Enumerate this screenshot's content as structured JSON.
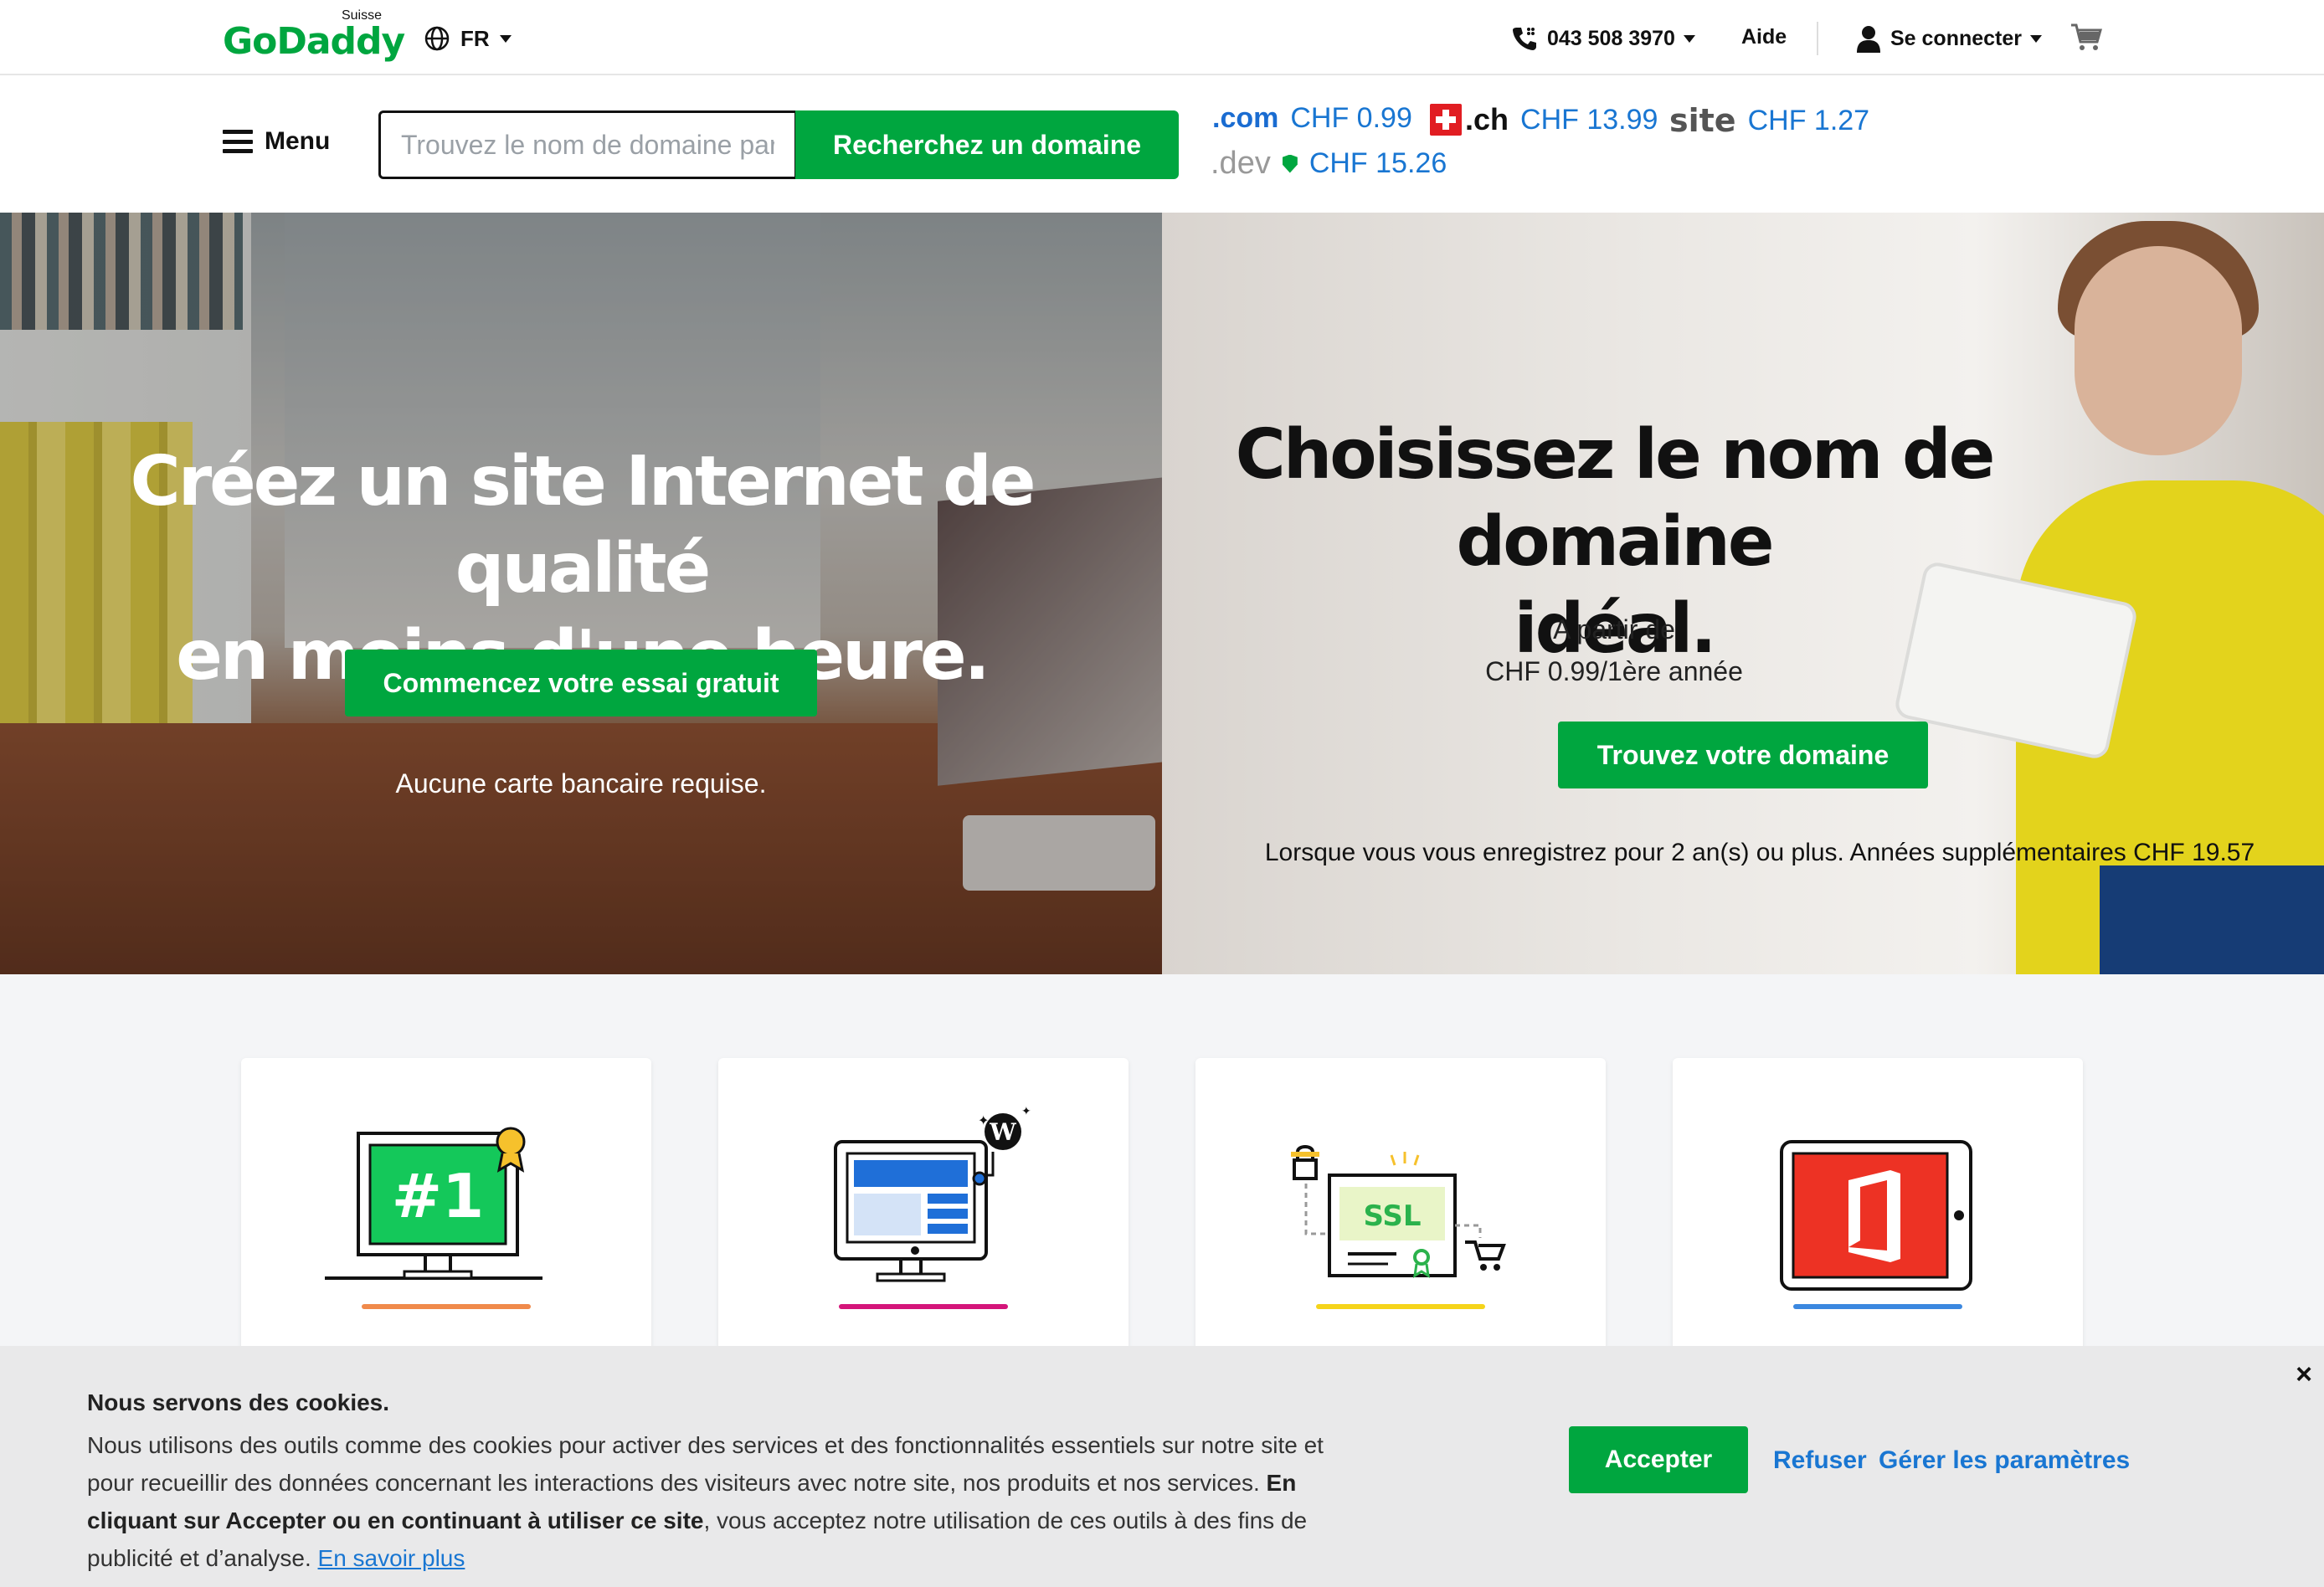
{
  "topbar": {
    "logo_text": "GoDaddy",
    "logo_region": "Suisse",
    "language": "FR",
    "phone": "043 508 3970",
    "help": "Aide",
    "login": "Se connecter"
  },
  "search": {
    "menu_label": "Menu",
    "placeholder": "Trouvez le nom de domaine parfait",
    "button": "Recherchez un domaine",
    "tlds": [
      {
        "ext": ".com",
        "price": "CHF 0.99"
      },
      {
        "ext": ".ch",
        "price": "CHF 13.99"
      },
      {
        "ext": "site",
        "price": "CHF 1.27"
      },
      {
        "ext": ".dev",
        "price": "CHF 15.26"
      }
    ]
  },
  "hero_left": {
    "headline_line1": "Créez un site Internet de qualité",
    "headline_line2": "en moins d'une heure.",
    "cta": "Commencez votre essai gratuit",
    "note": "Aucune carte bancaire requise."
  },
  "hero_right": {
    "headline_line1": "Choisissez le nom de domaine",
    "headline_line2": "idéal.",
    "sub1": "A partir de",
    "sub2": "CHF 0.99/1ère année",
    "cta": "Trouvez votre domaine",
    "disclaimer": "Lorsque vous vous enregistrez pour 2 an(s) ou plus. Années supplémentaires CHF 19.57"
  },
  "products": {
    "cards": [
      {
        "icon": "ranking-number-one-icon",
        "accent": "#f08a4b"
      },
      {
        "icon": "website-builder-wordpress-icon",
        "accent": "#d4157a"
      },
      {
        "icon": "ssl-certificate-icon",
        "accent": "#f5d41a"
      },
      {
        "icon": "office-365-icon",
        "accent": "#3b88e0"
      }
    ],
    "ssl_label": "SSL"
  },
  "cookie": {
    "title": "Nous servons des cookies.",
    "text1": "Nous utilisons des outils comme des cookies pour activer des services et des fonctionnalités essentiels sur notre site et pour recueillir des données concernant les interactions des visiteurs avec notre site, nos produits et nos services.",
    "bold": "En cliquant sur Accepter ou en continuant à utiliser ce site",
    "text2": ", vous acceptez notre utilisation de ces outils à des fins de publicité et d’analyse.",
    "link": "En savoir plus",
    "accept": "Accepter",
    "refuse": "Refuser",
    "manage": "Gérer les paramètres",
    "close": "×"
  },
  "colors": {
    "brand_green": "#00a63f",
    "link_blue": "#1976d2"
  }
}
